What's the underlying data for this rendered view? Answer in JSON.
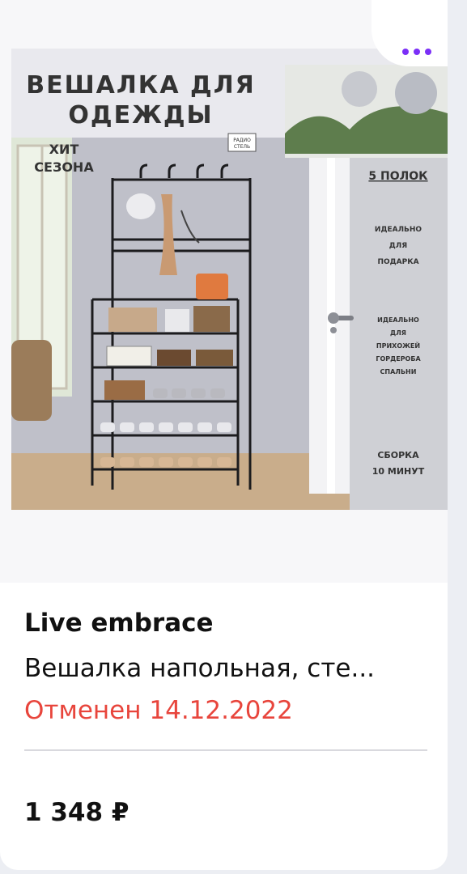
{
  "card": {
    "brand": "Live embrace",
    "title": "Вешалка напольная, сте...",
    "status": "Отменен 14.12.2022",
    "price": "1 348 ₽",
    "more_icon": "more-horizontal-icon"
  },
  "banner": {
    "headline_line1": "ВЕШАЛКА ДЛЯ",
    "headline_line2": "ОДЕЖДЫ",
    "hit_line1": "ХИТ",
    "hit_line2": "СЕЗОНА",
    "shelves": "5 ПОЛОК",
    "gift_line1": "ИДЕАЛЬНО",
    "gift_line2": "ДЛЯ",
    "gift_line3": "ПОДАРКА",
    "rooms_line1": "ИДЕАЛЬНО",
    "rooms_line2": "ДЛЯ",
    "rooms_line3": "ПРИХОЖЕЙ",
    "rooms_line4": "ГОРДЕРОБА",
    "rooms_line5": "СПАЛЬНИ",
    "assembly_line1": "СБОРКА",
    "assembly_line2": "10 МИНУТ",
    "badge_line1": "РАДИО",
    "badge_line2": "СТЕЛЬ"
  },
  "colors": {
    "accent": "#7b2ff7",
    "status_cancelled": "#e8453c"
  }
}
